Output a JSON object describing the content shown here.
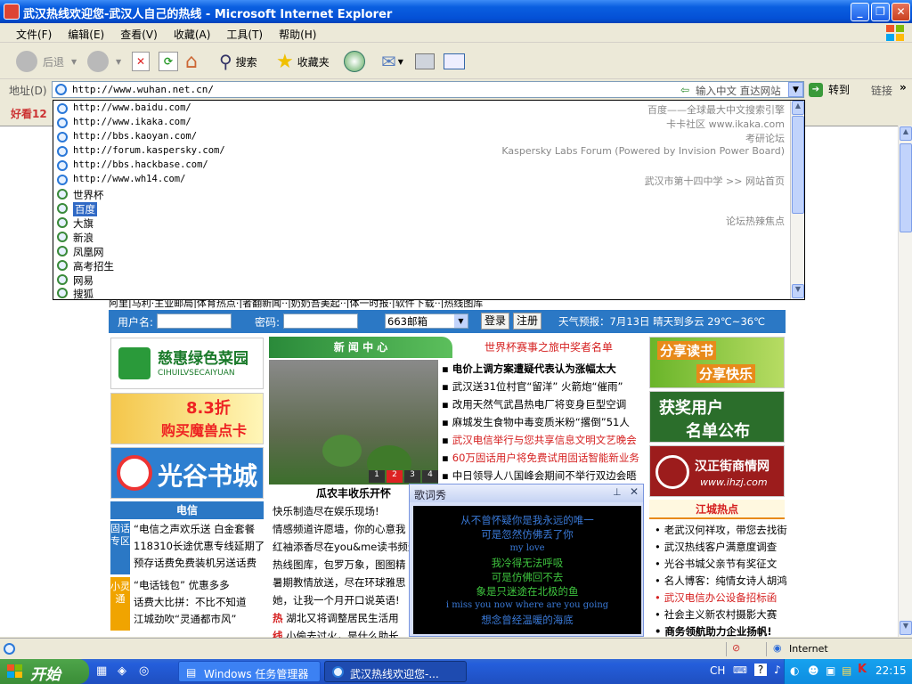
{
  "window": {
    "title": "武汉热线欢迎您-武汉人自己的热线 - Microsoft Internet Explorer"
  },
  "menu": [
    "文件(F)",
    "编辑(E)",
    "查看(V)",
    "收藏(A)",
    "工具(T)",
    "帮助(H)"
  ],
  "toolbar": {
    "back": "后退",
    "search": "搜索",
    "favorites": "收藏夹"
  },
  "address": {
    "label": "地址(D)",
    "url": "http://www.wuhan.net.cn/",
    "hint": "输入中文 直达网站",
    "go": "转到",
    "links": "链接"
  },
  "favbar": {
    "text": "好看12"
  },
  "dropdown": [
    {
      "url": "http://www.baidu.com/",
      "desc": "百度——全球最大中文搜索引擎",
      "type": "url"
    },
    {
      "url": "http://www.ikaka.com/",
      "desc": "卡卡社区 www.ikaka.com",
      "type": "url"
    },
    {
      "url": "http://bbs.kaoyan.com/",
      "desc": "考研论坛",
      "type": "url"
    },
    {
      "url": "http://forum.kaspersky.com/",
      "desc": "Kaspersky Labs Forum (Powered by Invision Power Board)",
      "type": "url"
    },
    {
      "url": "http://bbs.hackbase.com/",
      "desc": "",
      "type": "url"
    },
    {
      "url": "http://www.wh14.com/",
      "desc": "武汉市第十四中学 >> 网站首页",
      "type": "url"
    },
    {
      "url": "世界杯",
      "desc": "",
      "type": "kw"
    },
    {
      "url": "百度",
      "desc": "",
      "type": "kw",
      "selected": true
    },
    {
      "url": "大旗",
      "desc": "",
      "type": "kw"
    },
    {
      "url": "新浪",
      "desc": "论坛热辣焦点",
      "type": "kw"
    },
    {
      "url": "凤凰网",
      "desc": "",
      "type": "kw"
    },
    {
      "url": "高考招生",
      "desc": "",
      "type": "kw"
    },
    {
      "url": "网易",
      "desc": "",
      "type": "kw"
    },
    {
      "url": "搜狐",
      "desc": "",
      "type": "kw"
    }
  ],
  "page": {
    "topline": "阿里|马利·主业邮局|体育热点·|者翻新闻··|奶奶吾美起··|体一时报·|软件下载··|热线图库",
    "login": {
      "user": "用户名:",
      "pass": "密码:",
      "mailbox": "663邮箱",
      "login_btn": "登录",
      "register_btn": "注册",
      "weather": "天气预报：7月13日 晴天到多云 29℃~36℃"
    },
    "ads_left": [
      "慈惠绿色菜园",
      "CIHUILVSECAIYUAN",
      "8.3折",
      "购买魔兽点卡",
      "光谷书城"
    ],
    "telecom": {
      "title": "电信",
      "side": "固话专区",
      "side2": "小灵通",
      "items": [
        "“电信之声欢乐送 白金套餐",
        "118310长途优惠专线延期了",
        "预存话费免费装机另送话费",
        "“电话钱包” 优惠多多",
        "话费大比拼：不比不知道",
        "江城劲吹“灵通都市风”"
      ]
    },
    "news": {
      "header": "新 闻 中 心",
      "promo": "世界杯赛事之旅中奖者名单",
      "photo_caption": "瓜农丰收乐开怀",
      "pages": [
        "1",
        "2",
        "3",
        "4"
      ],
      "items": [
        {
          "t": "电价上调方案遭疑代表认为涨幅太大",
          "red": false,
          "bold": true
        },
        {
          "t": "武汉送31位村官“留洋” 火箭炮“催雨”",
          "red": false
        },
        {
          "t": "改用天然气武昌热电厂将变身巨型空调",
          "red": false
        },
        {
          "t": "麻城发生食物中毒变质米粉“撂倒”51人",
          "red": false
        },
        {
          "t": "武汉电信举行与您共享信息文明文艺晚会",
          "red": true
        },
        {
          "t": "60万固话用户将免费试用固话智能新业务",
          "red": true
        },
        {
          "t": "中日领导人八国峰会期间不举行双边会晤",
          "red": false
        }
      ],
      "lower": [
        "快乐制造尽在娱乐现场!",
        "情感频道许愿墙，你的心意我",
        "红袖添香尽在you&me读书频道",
        "热线图库，包罗万象，图图精",
        "暑期教情放送，尽在环球雅思",
        "她，让我一个月开口说英语!",
        "湖北又将调整居民生活用",
        "小偷去过火，是什么助长"
      ],
      "lower_tags": [
        "热",
        "线"
      ]
    },
    "ads_right": [
      "分享读书",
      "分享快乐",
      "获奖用户",
      "名单公布",
      "汉正街商情网",
      "www.ihzj.com"
    ],
    "hotspot": {
      "title": "江城热点",
      "items": [
        {
          "t": "老武汉何祥攻，带您去找街",
          "red": false
        },
        {
          "t": "武汉热线客户满意度调查",
          "red": false
        },
        {
          "t": "光谷书城父亲节有奖征文",
          "red": false
        },
        {
          "t": "名人博客：纯情女诗人胡鸿",
          "red": false
        },
        {
          "t": "武汉电信办公设备招标函",
          "red": true
        },
        {
          "t": "社会主义新农村摄影大赛",
          "red": false
        },
        {
          "t": "商务领航助力企业扬帆!",
          "red": false,
          "bold": true
        }
      ]
    }
  },
  "lyrics": {
    "title": "歌词秀",
    "lines": [
      "从不曾怀疑你是我永远的唯一",
      "可是忽然仿佛丢了你",
      "my love",
      "我冷得无法呼吸",
      "可是仿佛回不去",
      "象是只迷途在北极的鱼",
      "i miss you now where are you going",
      "想念曾经温暖的海底"
    ]
  },
  "status": {
    "zone": "Internet"
  },
  "taskbar": {
    "start": "开始",
    "tasks": [
      "Windows 任务管理器",
      "武汉热线欢迎您-..."
    ],
    "tray_lang": "CH",
    "clock": "22:15"
  }
}
